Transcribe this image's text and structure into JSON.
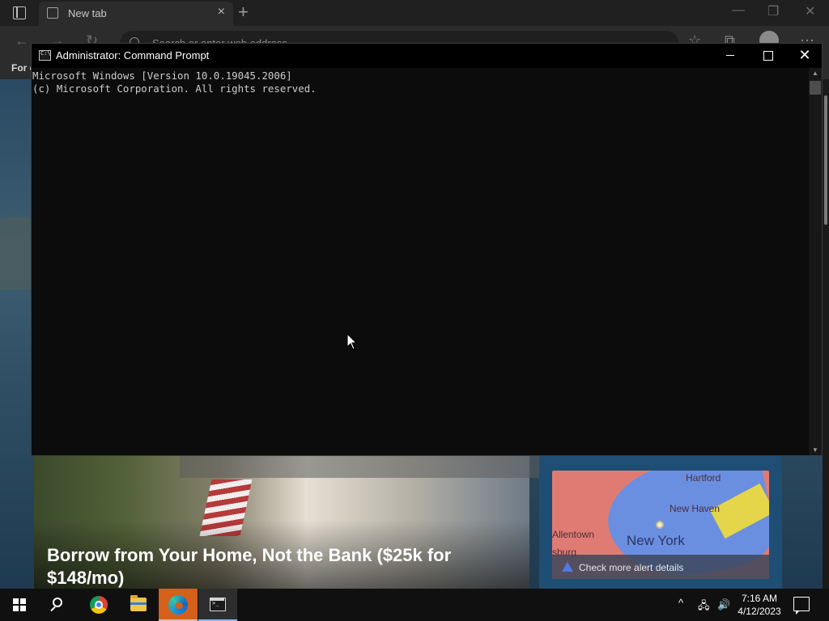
{
  "browser": {
    "tab_title": "New tab",
    "address_placeholder": "Search or enter web address",
    "favorites_label": "For q",
    "new_tab_glyph": "+",
    "close_glyph": "×"
  },
  "news": {
    "home_headline": "Borrow from Your Home, Not the Bank ($25k for $148/mo)",
    "map_labels": {
      "hartford": "Hartford",
      "new_haven": "New Haven",
      "allentown": "Allentown",
      "burg": "sburg",
      "new_york": "New York"
    },
    "alert_text": "Check more alert details"
  },
  "cmd": {
    "title": "Administrator: Command Prompt",
    "lines": [
      "Microsoft Windows [Version 10.0.19045.2006]",
      "(c) Microsoft Corporation. All rights reserved."
    ]
  },
  "taskbar": {
    "time": "7:16 AM",
    "date": "4/12/2023",
    "apps": [
      "Start",
      "Search",
      "Google Chrome",
      "File Explorer",
      "Microsoft Edge",
      "Command Prompt"
    ]
  },
  "icons": {
    "tray_chevron": "^",
    "network": "network-icon",
    "volume": "volume-icon",
    "notifications": "notification-icon"
  }
}
